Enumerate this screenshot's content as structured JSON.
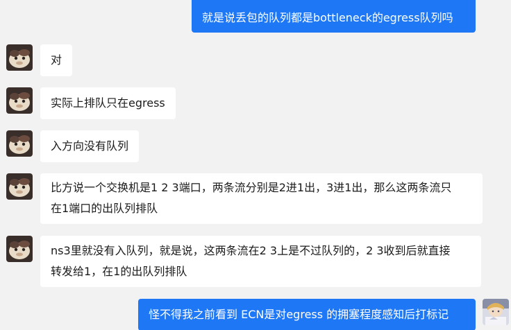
{
  "chat": {
    "messages": [
      {
        "side": "out",
        "text": "就是说丢包的队列都是bottleneck的egress队列吗"
      },
      {
        "side": "in",
        "text": "对"
      },
      {
        "side": "in",
        "text": "实际上排队只在egress"
      },
      {
        "side": "in",
        "text": "入方向没有队列"
      },
      {
        "side": "in",
        "lines": [
          "比方说一个交换机是1 2 3端口，两条流分别是2进1出，3进1出，那么这两条流只",
          "在1端口的出队列排队"
        ]
      },
      {
        "side": "in",
        "lines": [
          "ns3里就没有入队列，就是说，这两条流在2 3上是不过队列的，2 3收到后就直接",
          "转发给1，在1的出队列排队"
        ]
      },
      {
        "side": "out",
        "text": "怪不得我之前看到 ECN是对egress 的拥塞程度感知后打标记"
      }
    ]
  },
  "colors": {
    "background": "#f2f2f2",
    "incoming_bubble": "#ffffff",
    "outgoing_bubble": "#1e78f5",
    "outgoing_text": "#ffffff"
  }
}
